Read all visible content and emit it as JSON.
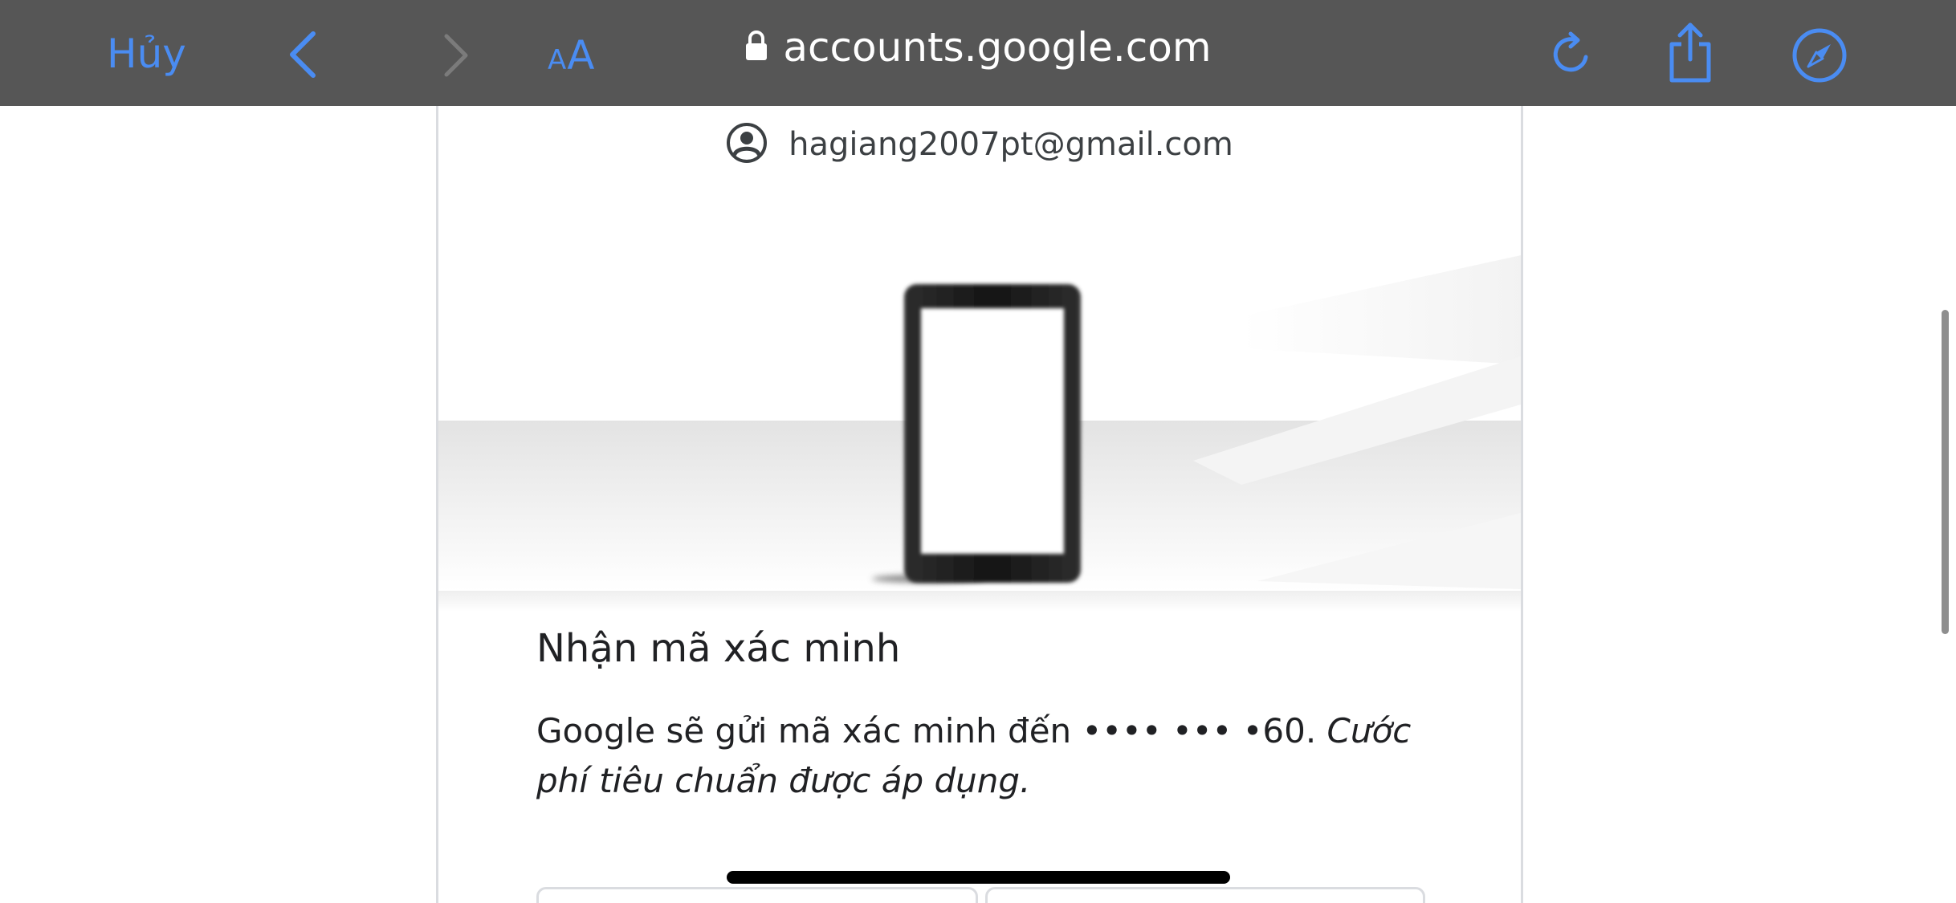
{
  "browser": {
    "cancel_label": "Hủy",
    "text_size_small": "A",
    "text_size_large": "A",
    "url": "accounts.google.com",
    "accent_color": "#4a8cf2",
    "toolbar_color": "#565656",
    "icons": [
      "back-icon",
      "forward-icon",
      "lock-icon",
      "reload-icon",
      "share-icon",
      "compass-icon"
    ]
  },
  "page": {
    "account_email": "hagiang2007pt@gmail.com",
    "title": "Nhận mã xác minh",
    "description_plain": "Google sẽ gửi mã xác minh đến •••• ••• •60. ",
    "description_italic": "Cước phí tiêu chuẩn được áp dụng."
  }
}
